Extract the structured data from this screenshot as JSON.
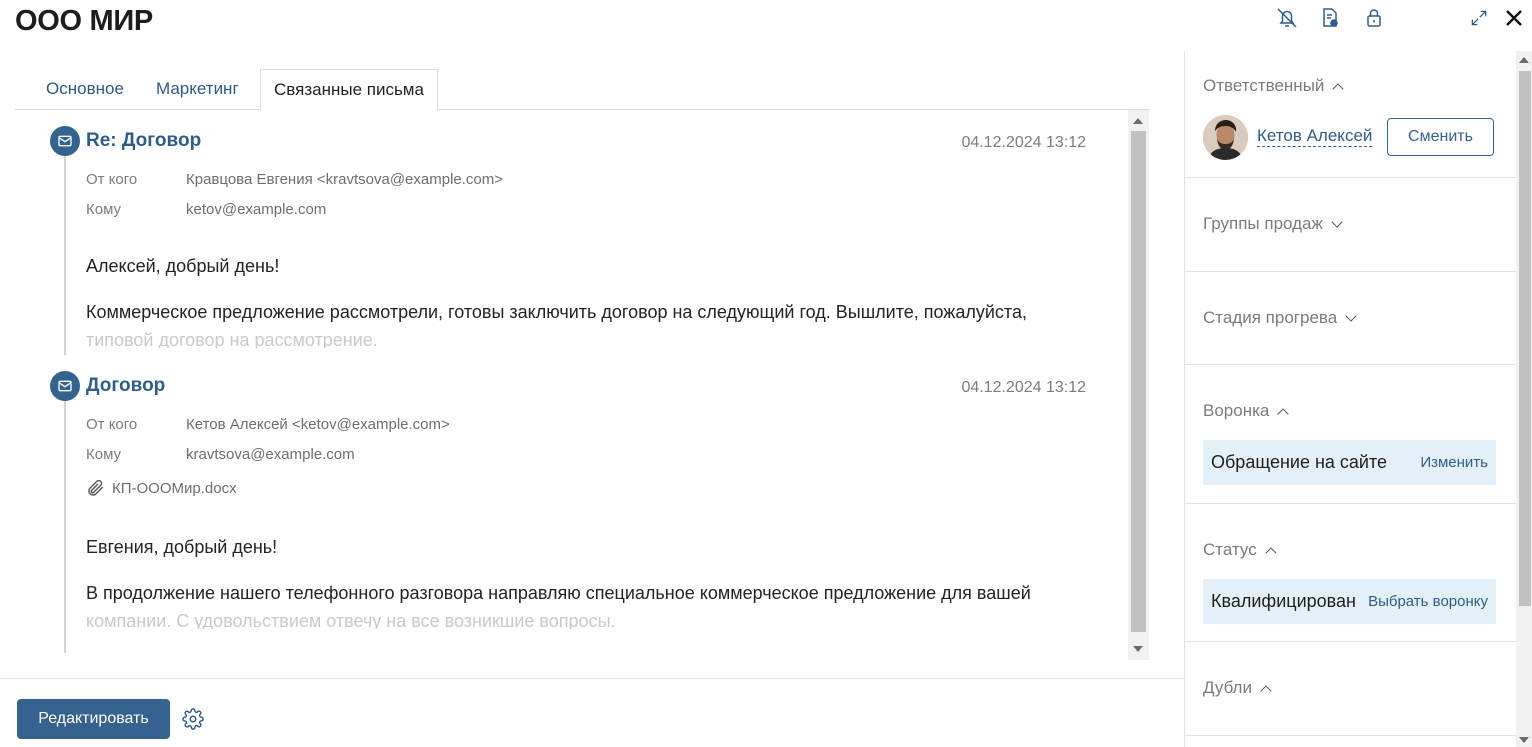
{
  "header": {
    "title": "ООО МИР",
    "icons": [
      "bell-off-icon",
      "document-badge-icon",
      "lock-icon",
      "expand-icon",
      "close-icon"
    ]
  },
  "tabs": [
    {
      "label": "Основное",
      "active": false
    },
    {
      "label": "Маркетинг",
      "active": false
    },
    {
      "label": "Связанные письма",
      "active": true
    }
  ],
  "letters": [
    {
      "subject": "Re: Договор",
      "date": "04.12.2024 13:12",
      "from_label": "От кого",
      "from": "Кравцова Евгения <kravtsova@example.com>",
      "to_label": "Кому",
      "to": "ketov@example.com",
      "greeting": "Алексей, добрый день!",
      "text": "Коммерческое предложение рассмотрели, готовы заключить договор на следующий год. Вышлите, пожалуйста,",
      "text_faded": "типовой договор на рассмотрение."
    },
    {
      "subject": "Договор",
      "date": "04.12.2024 13:12",
      "from_label": "От кого",
      "from": "Кетов Алексей <ketov@example.com>",
      "to_label": "Кому",
      "to": "kravtsova@example.com",
      "attachment": "КП-ОООМир.docx",
      "greeting": "Евгения, добрый день!",
      "text": "В продолжение нашего телефонного разговора направляю специальное коммерческое предложение для вашей",
      "text_faded": "компании. С удовольствием отвечу на все возникшие вопросы."
    }
  ],
  "footer": {
    "edit_label": "Редактировать"
  },
  "sidebar": {
    "responsible": {
      "title": "Ответственный",
      "person": "Кетов Алексей",
      "change_label": "Сменить"
    },
    "sales_groups": {
      "title": "Группы продаж"
    },
    "warmup_stage": {
      "title": "Стадия прогрева"
    },
    "funnel": {
      "title": "Воронка",
      "value": "Обращение на сайте",
      "action": "Изменить"
    },
    "status": {
      "title": "Статус",
      "value": "Квалифицирован",
      "action": "Выбрать воронку"
    },
    "duplicates": {
      "title": "Дубли"
    }
  },
  "colors": {
    "accent": "#36628f",
    "link": "#2f5d8b",
    "value_bg": "#e4f0f7"
  }
}
